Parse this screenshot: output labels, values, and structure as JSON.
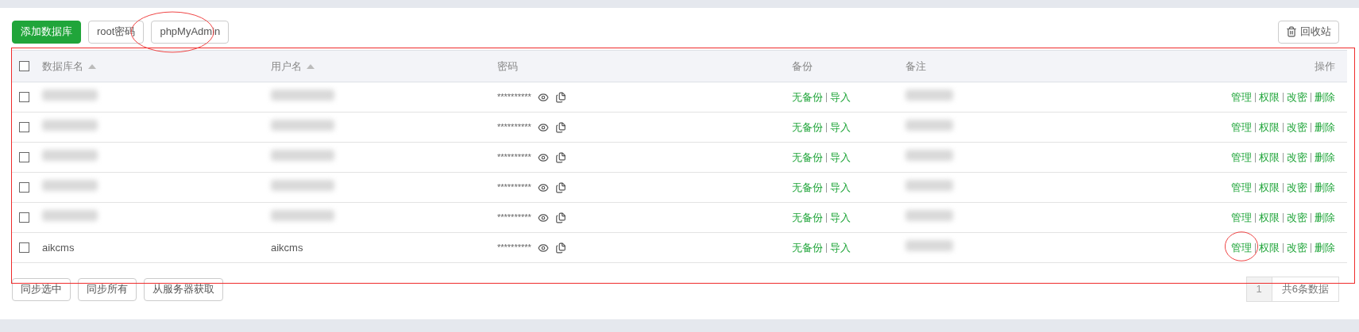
{
  "toolbar": {
    "buttons": [
      {
        "label": "添加数据库",
        "kind": "primary",
        "circled": false
      },
      {
        "label": "root密码",
        "kind": "default",
        "circled": false
      },
      {
        "label": "phpMyAdmin",
        "kind": "default",
        "circled": true
      }
    ],
    "recycle_button": {
      "label": "回收站"
    }
  },
  "table": {
    "outlined": true,
    "columns": [
      {
        "label": "数据库名",
        "sortable": true
      },
      {
        "label": "用户名",
        "sortable": true
      },
      {
        "label": "密码",
        "sortable": false
      },
      {
        "label": "备份",
        "sortable": false
      },
      {
        "label": "备注",
        "sortable": false
      },
      {
        "label": "操作",
        "sortable": false
      }
    ],
    "header_checked": false,
    "rows": [
      {
        "redacted": true,
        "checked": false,
        "password": "**********",
        "backup": "无备份",
        "import": "导入",
        "actions": [
          {
            "label": "管理",
            "circled": false
          },
          {
            "label": "权限",
            "circled": false
          },
          {
            "label": "改密",
            "circled": false
          },
          {
            "label": "删除",
            "circled": false
          }
        ]
      },
      {
        "redacted": true,
        "checked": false,
        "password": "**********",
        "backup": "无备份",
        "import": "导入",
        "actions": [
          {
            "label": "管理",
            "circled": false
          },
          {
            "label": "权限",
            "circled": false
          },
          {
            "label": "改密",
            "circled": false
          },
          {
            "label": "删除",
            "circled": false
          }
        ]
      },
      {
        "redacted": true,
        "checked": false,
        "password": "**********",
        "backup": "无备份",
        "import": "导入",
        "actions": [
          {
            "label": "管理",
            "circled": false
          },
          {
            "label": "权限",
            "circled": false
          },
          {
            "label": "改密",
            "circled": false
          },
          {
            "label": "删除",
            "circled": false
          }
        ]
      },
      {
        "redacted": true,
        "checked": false,
        "password": "**********",
        "backup": "无备份",
        "import": "导入",
        "actions": [
          {
            "label": "管理",
            "circled": false
          },
          {
            "label": "权限",
            "circled": false
          },
          {
            "label": "改密",
            "circled": false
          },
          {
            "label": "删除",
            "circled": false
          }
        ]
      },
      {
        "redacted": true,
        "checked": false,
        "password": "**********",
        "backup": "无备份",
        "import": "导入",
        "actions": [
          {
            "label": "管理",
            "circled": false
          },
          {
            "label": "权限",
            "circled": false
          },
          {
            "label": "改密",
            "circled": false
          },
          {
            "label": "删除",
            "circled": false
          }
        ]
      },
      {
        "redacted": false,
        "name": "aikcms",
        "user": "aikcms",
        "checked": false,
        "password": "**********",
        "backup": "无备份",
        "import": "导入",
        "actions": [
          {
            "label": "管理",
            "circled": true
          },
          {
            "label": "权限",
            "circled": false
          },
          {
            "label": "改密",
            "circled": false
          },
          {
            "label": "删除",
            "circled": false
          }
        ]
      }
    ]
  },
  "footer": {
    "buttons": [
      "同步选中",
      "同步所有",
      "从服务器获取"
    ],
    "pagination": {
      "pages": [
        {
          "label": "1",
          "selected": true
        }
      ],
      "total": "共6条数据"
    }
  }
}
